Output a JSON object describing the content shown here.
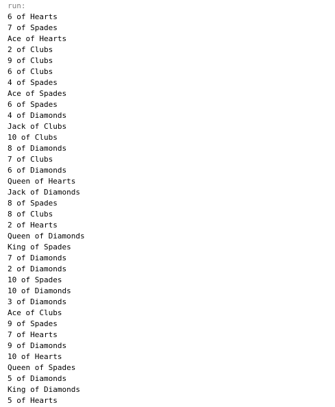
{
  "console": {
    "header": "run:",
    "lines": [
      "6 of Hearts",
      "7 of Spades",
      "Ace of Hearts",
      "2 of Clubs",
      "9 of Clubs",
      "6 of Clubs",
      "4 of Spades",
      "Ace of Spades",
      "6 of Spades",
      "4 of Diamonds",
      "Jack of Clubs",
      "10 of Clubs",
      "8 of Diamonds",
      "7 of Clubs",
      "6 of Diamonds",
      "Queen of Hearts",
      "Jack of Diamonds",
      "8 of Spades",
      "8 of Clubs",
      "2 of Hearts",
      "Queen of Diamonds",
      "King of Spades",
      "7 of Diamonds",
      "2 of Diamonds",
      "10 of Spades",
      "10 of Diamonds",
      "3 of Diamonds",
      "Ace of Clubs",
      "9 of Spades",
      "7 of Hearts",
      "9 of Diamonds",
      "10 of Hearts",
      "Queen of Spades",
      "5 of Diamonds",
      "King of Diamonds",
      "5 of Hearts"
    ]
  }
}
